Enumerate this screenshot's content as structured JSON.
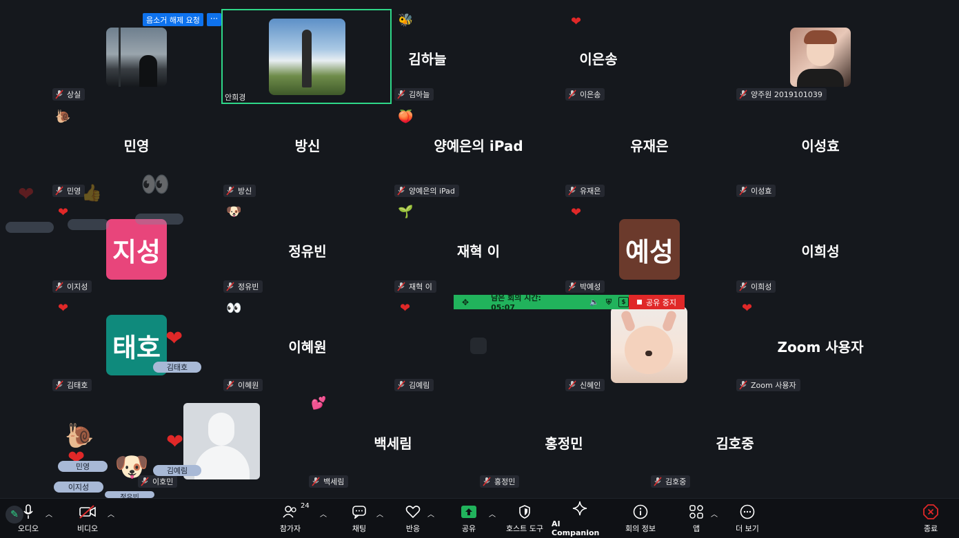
{
  "controls": {
    "unmute_request": "음소거 해제 요청",
    "more": "···"
  },
  "participants": [
    {
      "name": "상실",
      "big": "",
      "kind": "photo"
    },
    {
      "name": "안희경",
      "big": "",
      "kind": "photo"
    },
    {
      "name": "김하늘",
      "big": "김하늘",
      "kind": "text"
    },
    {
      "name": "이은송",
      "big": "이은송",
      "kind": "text"
    },
    {
      "name": "양주원 2019101039",
      "big": "",
      "kind": "photo"
    },
    {
      "name": "민영",
      "big": "민영",
      "kind": "text"
    },
    {
      "name": "방신",
      "big": "방신",
      "kind": "text"
    },
    {
      "name": "양예은의 iPad",
      "big": "양예은의 iPad",
      "kind": "text"
    },
    {
      "name": "유재은",
      "big": "유재은",
      "kind": "text"
    },
    {
      "name": "이성효",
      "big": "이성효",
      "kind": "text"
    },
    {
      "name": "이지성",
      "big": "지성",
      "kind": "avatar",
      "color": "#e8457b"
    },
    {
      "name": "정유빈",
      "big": "정유빈",
      "kind": "text"
    },
    {
      "name": "재혁 이",
      "big": "재혁 이",
      "kind": "text"
    },
    {
      "name": "박예성",
      "big": "예성",
      "kind": "avatar",
      "color": "#6b3a2c"
    },
    {
      "name": "이희성",
      "big": "이희성",
      "kind": "text"
    },
    {
      "name": "김태호",
      "big": "태호",
      "kind": "avatar",
      "color": "#0f8a7c"
    },
    {
      "name": "이혜원",
      "big": "이혜원",
      "kind": "text"
    },
    {
      "name": "김예림",
      "big": "",
      "kind": "text"
    },
    {
      "name": "신혜인",
      "big": "",
      "kind": "photo"
    },
    {
      "name": "Zoom 사용자",
      "big": "Zoom 사용자",
      "kind": "text"
    },
    {
      "name": "이호민",
      "big": "",
      "kind": "photo"
    },
    {
      "name": "백세림",
      "big": "백세림",
      "kind": "text"
    },
    {
      "name": "홍정민",
      "big": "홍정민",
      "kind": "text"
    },
    {
      "name": "김호중",
      "big": "김호중",
      "kind": "text"
    }
  ],
  "share_bar": {
    "remaining": "남은 회의 시간: 05:07",
    "stop": "공유 중지"
  },
  "floating_tags": [
    "김태호",
    "민영",
    "이지성",
    "정유빈",
    "김예림"
  ],
  "toolbar": {
    "audio": "오디오",
    "video": "비디오",
    "participants": "참가자",
    "participant_count": "24",
    "chat": "채팅",
    "reactions": "반응",
    "share": "공유",
    "host_tools": "호스트 도구",
    "ai": "AI Companion",
    "info": "회의 정보",
    "apps": "앱",
    "more": "더 보기",
    "end": "종료"
  },
  "colors": {
    "background": "#15181d",
    "active_speaker": "#2fd889",
    "share_bar": "#21b35c",
    "stop": "#e02828",
    "end": "#e02828"
  }
}
